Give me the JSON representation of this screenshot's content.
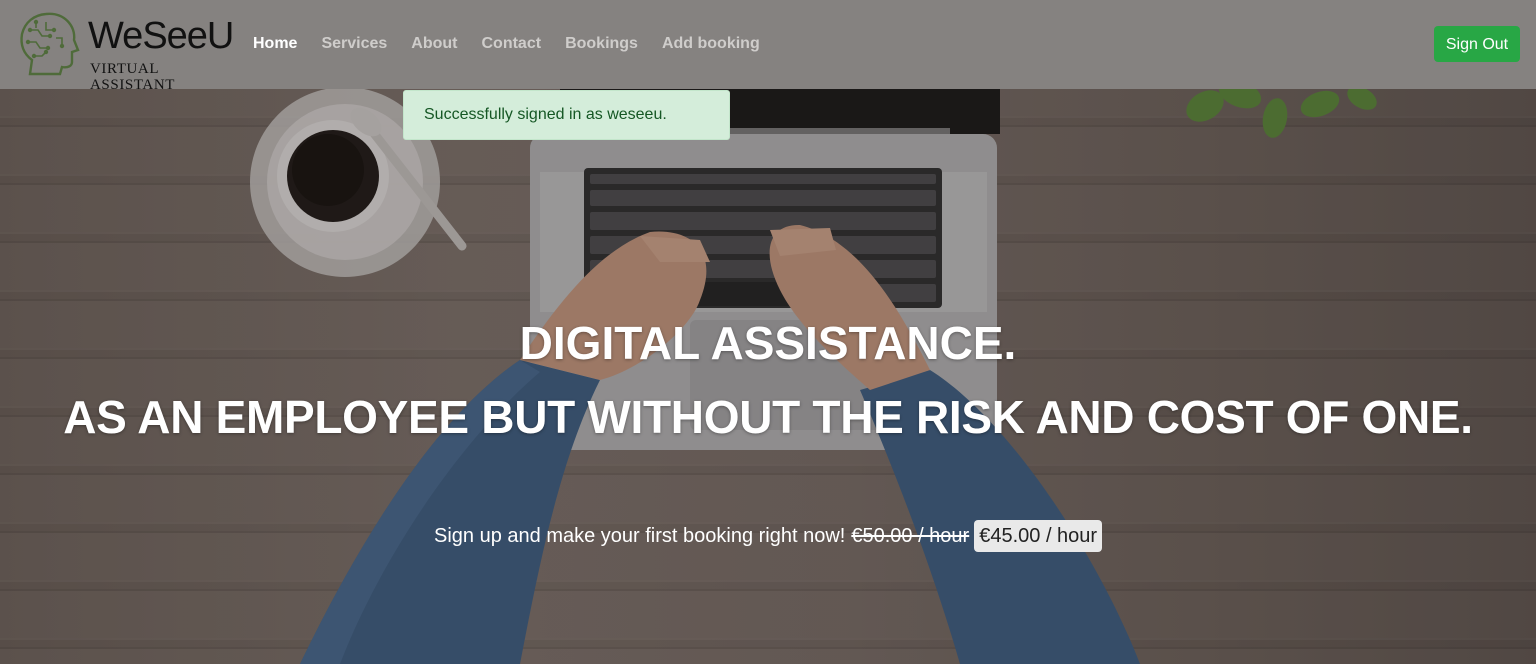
{
  "brand": {
    "name": "WeSeeU",
    "tagline": "VIRTUAL ASSISTANT",
    "logo_icon": "brain-circuit-head-icon"
  },
  "nav": {
    "items": [
      {
        "label": "Home",
        "active": true
      },
      {
        "label": "Services",
        "active": false
      },
      {
        "label": "About",
        "active": false
      },
      {
        "label": "Contact",
        "active": false
      },
      {
        "label": "Bookings",
        "active": false
      },
      {
        "label": "Add booking",
        "active": false
      }
    ],
    "signout_label": "Sign Out"
  },
  "alert": {
    "message": "Successfully signed in as weseeu.",
    "type": "success"
  },
  "hero": {
    "headline_line1": "DIGITAL ASSISTANCE.",
    "headline_line2": "AS AN EMPLOYEE BUT WITHOUT THE RISK AND COST OF ONE.",
    "promo_text": "Sign up and make your first booking right now!",
    "old_price": "€50.00 / hour",
    "new_price": "€45.00 / hour"
  },
  "colors": {
    "navbar_bg": "#858280",
    "signout_bg": "#28a745",
    "alert_bg": "#d4edda",
    "alert_text": "#155724"
  }
}
